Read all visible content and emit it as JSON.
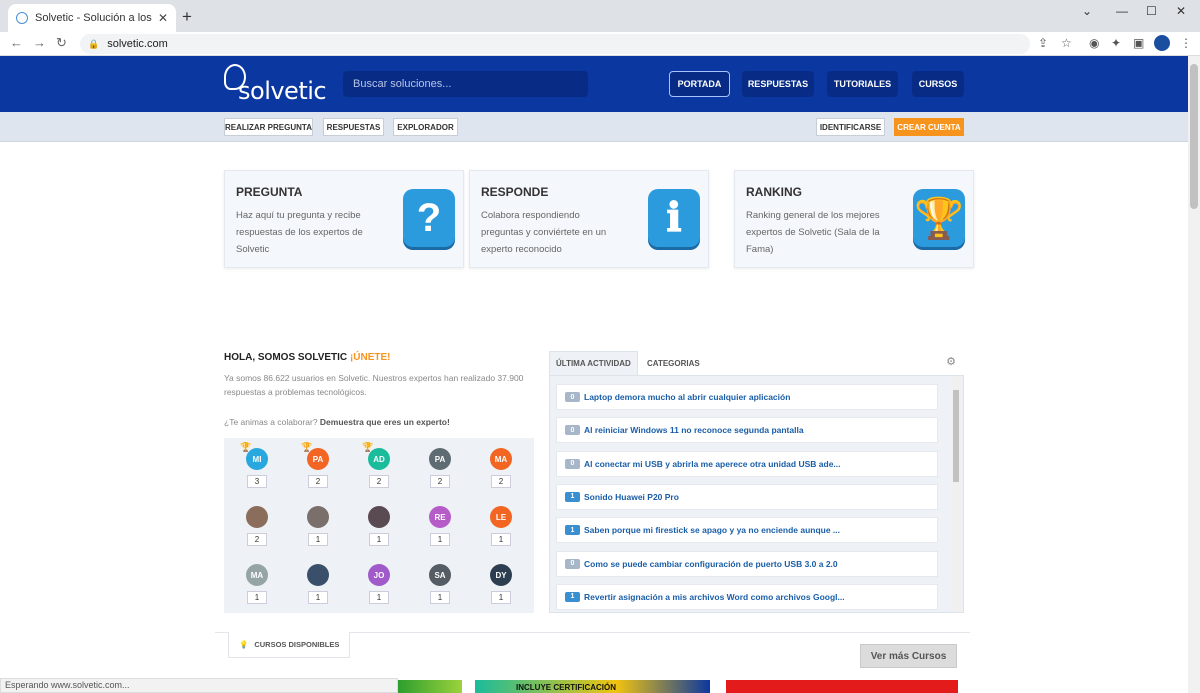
{
  "browser": {
    "tab_title": "Solvetic - Solución a los problem",
    "url": "solvetic.com",
    "status": "Esperando www.solvetic.com..."
  },
  "site": {
    "logo_text": "solvetic",
    "search_placeholder": "Buscar soluciones...",
    "nav": [
      "PORTADA",
      "RESPUESTAS",
      "TUTORIALES",
      "CURSOS"
    ],
    "subnav": [
      "REALIZAR PREGUNTA",
      "RESPUESTAS",
      "EXPLORADOR"
    ],
    "identify": "IDENTIFICARSE",
    "create_account": "CREAR CUENTA"
  },
  "cards": [
    {
      "title": "PREGUNTA",
      "text": "Haz aquí tu pregunta y recibe respuestas de los expertos de Solvetic",
      "icon": "question-icon"
    },
    {
      "title": "RESPONDE",
      "text": "Colabora respondiendo preguntas y conviértete en un experto reconocido",
      "icon": "info-icon"
    },
    {
      "title": "RANKING",
      "text": "Ranking general de los mejores expertos de Solvetic (Sala de la Fama)",
      "icon": "trophy-icon"
    }
  ],
  "community": {
    "hello": "HOLA, SOMOS SOLVETIC",
    "join": "¡ÚNETE!",
    "intro": "Ya somos 86.622 usuarios en Solvetic. Nuestros expertos han realizado 37.900 respuestas a problemas tecnológicos.",
    "cta_pre": "¿Te animas a colaborar?",
    "cta_bold": "Demuestra que eres un experto!",
    "users": [
      {
        "initials": "MI",
        "count": "3",
        "color": "#29a8e0"
      },
      {
        "initials": "PA",
        "count": "2",
        "color": "#f26522"
      },
      {
        "initials": "AD",
        "count": "2",
        "color": "#1abc9c"
      },
      {
        "initials": "PA",
        "count": "2",
        "color": "#5f6b73"
      },
      {
        "initials": "MA",
        "count": "2",
        "color": "#f26522"
      },
      {
        "initials": "",
        "count": "2",
        "color": "#8a6d5a"
      },
      {
        "initials": "",
        "count": "1",
        "color": "#7a6f6a"
      },
      {
        "initials": "",
        "count": "1",
        "color": "#5a4a52"
      },
      {
        "initials": "RE",
        "count": "1",
        "color": "#b55cc9"
      },
      {
        "initials": "LE",
        "count": "1",
        "color": "#f26522"
      },
      {
        "initials": "MA",
        "count": "1",
        "color": "#95a5a6"
      },
      {
        "initials": "",
        "count": "1",
        "color": "#3a4f6a"
      },
      {
        "initials": "JO",
        "count": "1",
        "color": "#a05ac9"
      },
      {
        "initials": "SA",
        "count": "1",
        "color": "#555c63"
      },
      {
        "initials": "DY",
        "count": "1",
        "color": "#2c3e50"
      }
    ]
  },
  "activity": {
    "tabs": [
      "ÚLTIMA ACTIVIDAD",
      "CATEGORIAS"
    ],
    "items": [
      {
        "count": "0",
        "text": "Laptop demora mucho al abrir cualquier aplicación"
      },
      {
        "count": "0",
        "text": "Al reiniciar Windows 11 no reconoce segunda pantalla"
      },
      {
        "count": "0",
        "text": "Al conectar mi USB y abrirla me aperece otra unidad USB ade..."
      },
      {
        "count": "1",
        "text": "Sonido Huawei P20 Pro"
      },
      {
        "count": "1",
        "text": "Saben porque mi firestick se apago y ya no enciende aunque ..."
      },
      {
        "count": "0",
        "text": "Como se puede cambiar configuración de puerto USB 3.0 a 2.0"
      },
      {
        "count": "1",
        "text": "Revertir asignación a mis archivos Word como archivos Googl..."
      }
    ]
  },
  "courses": {
    "tab": "CURSOS DISPONIBLES",
    "more": "Ver más Cursos",
    "cert": "INCLUYE CERTIFICACIÓN"
  }
}
